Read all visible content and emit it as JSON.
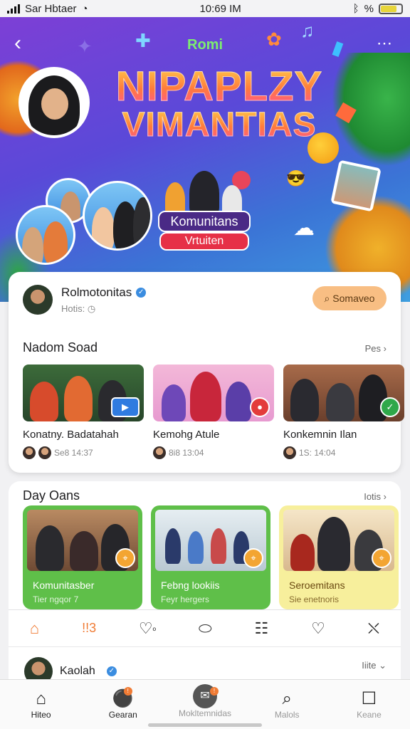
{
  "status": {
    "carrier": "Sar Hbtaer",
    "time": "10:69 IM",
    "right_text": "%"
  },
  "hero": {
    "kicker": "Romi",
    "title_line1": "NIPAPLZY",
    "title_line2": "VIMANTIAS",
    "pill_top": "Komunitans",
    "pill_bottom": "Vrtuiten"
  },
  "profile": {
    "name": "Rolmotonitas",
    "sub": "Hotis:",
    "button": "Somaveo"
  },
  "section1": {
    "title": "Nadom Soad",
    "more": "Pes",
    "items": [
      {
        "label": "Konatny. Badatahah",
        "meta": "Se8 14:37"
      },
      {
        "label": "Kemohg Atule",
        "meta": "8i8 13:04"
      },
      {
        "label": "Konkemnin Ilan",
        "meta": "1S: 14:04"
      }
    ]
  },
  "section2": {
    "title": "Day Oans",
    "more": "Iotis",
    "items": [
      {
        "title": "Komunitasber",
        "sub": "Tier ngqor 7"
      },
      {
        "title": "Febng lookiis",
        "sub": "Feyr hergers"
      },
      {
        "title": "Seroemitans",
        "sub": "Sie enetnoris"
      }
    ]
  },
  "actions": {
    "a2": "!!3",
    "a3": "º"
  },
  "next_post": {
    "name": "Kaolah",
    "more": "Iiite"
  },
  "tabs": [
    {
      "label": "Hiteo"
    },
    {
      "label": "Gearan"
    },
    {
      "label": "Mokltemnidas"
    },
    {
      "label": "Malols"
    },
    {
      "label": "Keane"
    }
  ],
  "colors": {
    "accent": "#f07b34",
    "hero_start": "#7d3fd6",
    "hero_end": "#3e9fe0",
    "group1": "#5fbf49",
    "group3": "#f7ef9c"
  }
}
